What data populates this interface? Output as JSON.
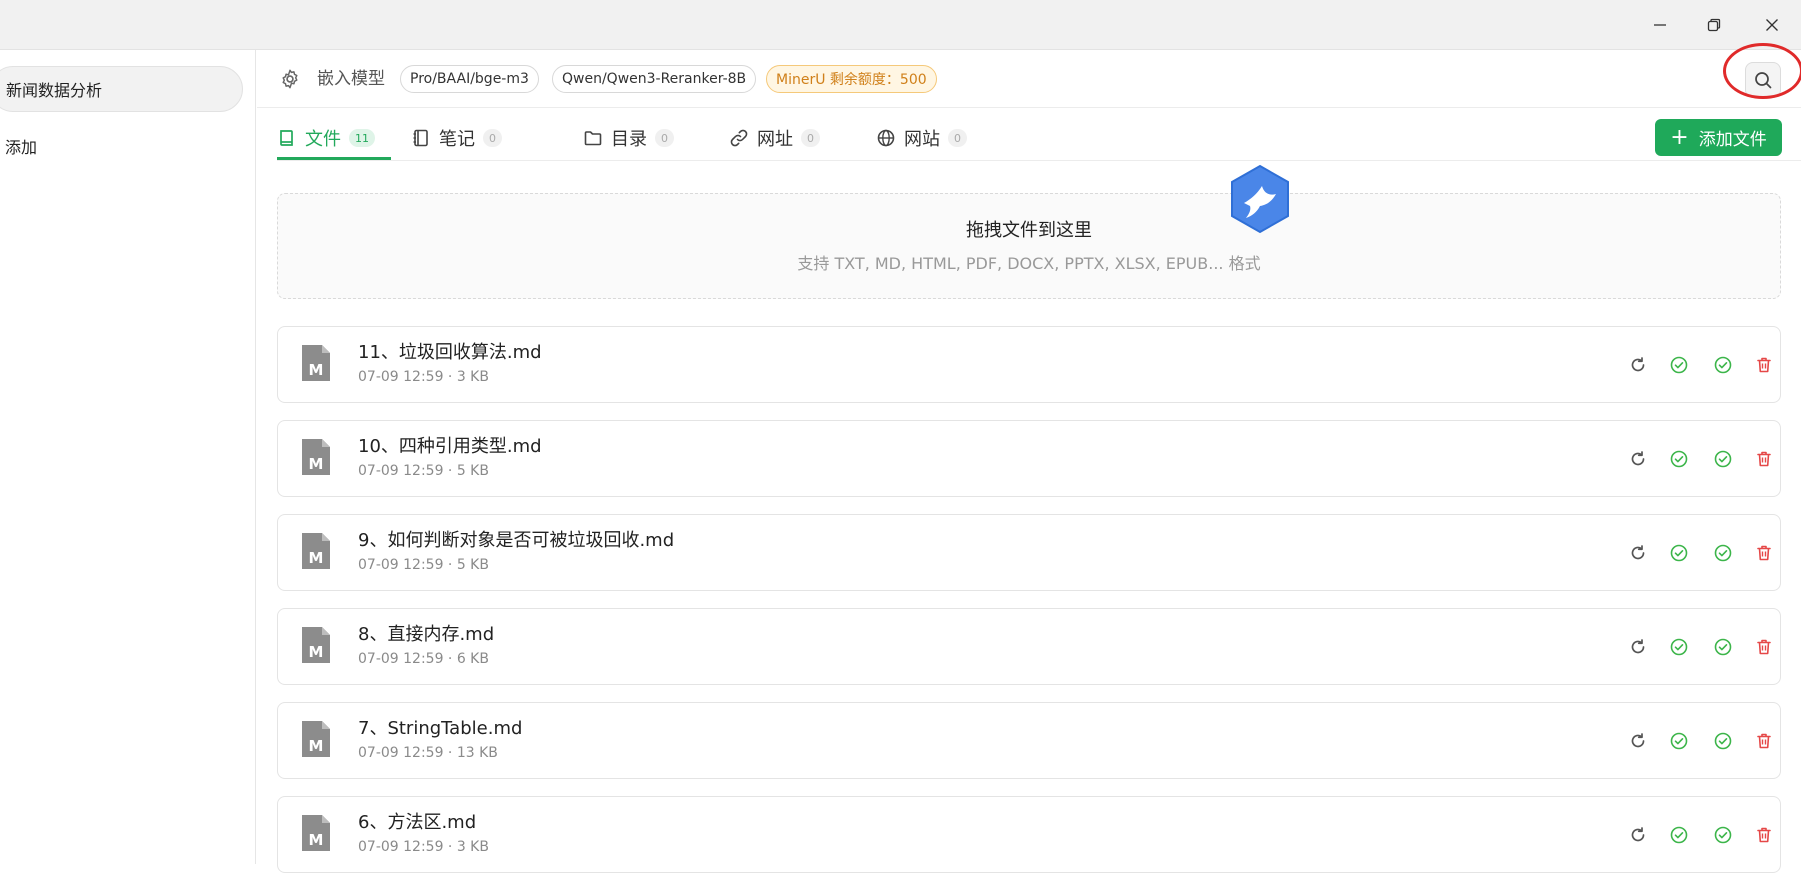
{
  "titlebar": {
    "minimize": "minimize",
    "restore": "restore",
    "close": "close"
  },
  "sidebar": {
    "knowledge_bases": [
      {
        "label": "新闻数据分析"
      }
    ],
    "add_label": "添加"
  },
  "topbar": {
    "embed_label": "嵌入模型",
    "chips": [
      "Pro/BAAI/bge-m3",
      "Qwen/Qwen3-Reranker-8B",
      "MinerU 剩余额度：500"
    ],
    "accent_color": "#22a95b",
    "warn_color": "#d0801a",
    "highlight_color": "#e02a2a"
  },
  "tabs": [
    {
      "label": "文件",
      "count": "11",
      "icon": "book-icon"
    },
    {
      "label": "笔记",
      "count": "0",
      "icon": "notebook-icon"
    },
    {
      "label": "目录",
      "count": "0",
      "icon": "folder-icon"
    },
    {
      "label": "网址",
      "count": "0",
      "icon": "link-icon"
    },
    {
      "label": "网站",
      "count": "0",
      "icon": "globe-icon"
    }
  ],
  "add_file_label": "添加文件",
  "dropzone": {
    "title": "拖拽文件到这里",
    "subtitle": "支持 TXT, MD, HTML, PDF, DOCX, PPTX, XLSX, EPUB... 格式"
  },
  "files": [
    {
      "name": "11、垃圾回收算法.md",
      "meta": "07-09 12:59 · 3 KB",
      "type_letter": "M"
    },
    {
      "name": "10、四种引用类型.md",
      "meta": "07-09 12:59 · 5 KB",
      "type_letter": "M"
    },
    {
      "name": "9、如何判断对象是否可被垃圾回收.md",
      "meta": "07-09 12:59 · 5 KB",
      "type_letter": "M"
    },
    {
      "name": "8、直接内存.md",
      "meta": "07-09 12:59 · 6 KB",
      "type_letter": "M"
    },
    {
      "name": "7、StringTable.md",
      "meta": "07-09 12:59 · 13 KB",
      "type_letter": "M"
    },
    {
      "name": "6、方法区.md",
      "meta": "07-09 12:59 · 3 KB",
      "type_letter": "M"
    }
  ]
}
